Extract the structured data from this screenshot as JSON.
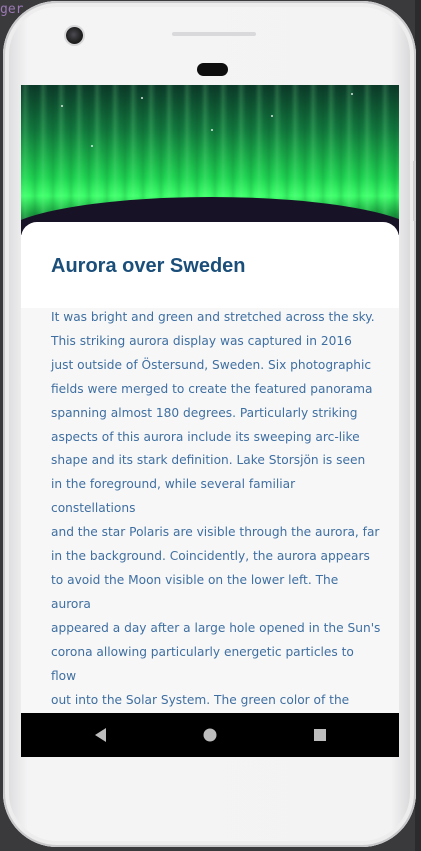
{
  "background": {
    "editor_snippet": "ger"
  },
  "article": {
    "title": "Aurora over Sweden",
    "body": "It was bright and green and stretched across the sky.\nThis striking aurora display was captured in 2016\njust outside of Östersund, Sweden. Six photographic\nfields were merged to create the featured panorama\nspanning almost 180 degrees.  Particularly striking\naspects of this aurora include its sweeping arc-like\nshape and its stark definition.  Lake Storsjön is seen\nin the foreground, while several familiar constellations\nand the star Polaris are visible through the aurora, far\nin the background.  Coincidently, the aurora appears\nto avoid the Moon visible on the lower left.  The aurora\nappeared a day after a large hole opened in the Sun's\ncorona allowing particularly energetic particles to flow\nout into the Solar System.  The green color of the aurora\nis caused by oxygen atoms recombining with ambient\nelectrons high in the Earth's atmosphere."
  },
  "navigation": {
    "back_icon": "back-triangle-icon",
    "home_icon": "home-circle-icon",
    "recents_icon": "recents-square-icon"
  },
  "colors": {
    "title": "#1b4f7a",
    "body_text": "#3f6fa0",
    "nav_bar": "#000000",
    "nav_icon": "#bdbdbd"
  }
}
